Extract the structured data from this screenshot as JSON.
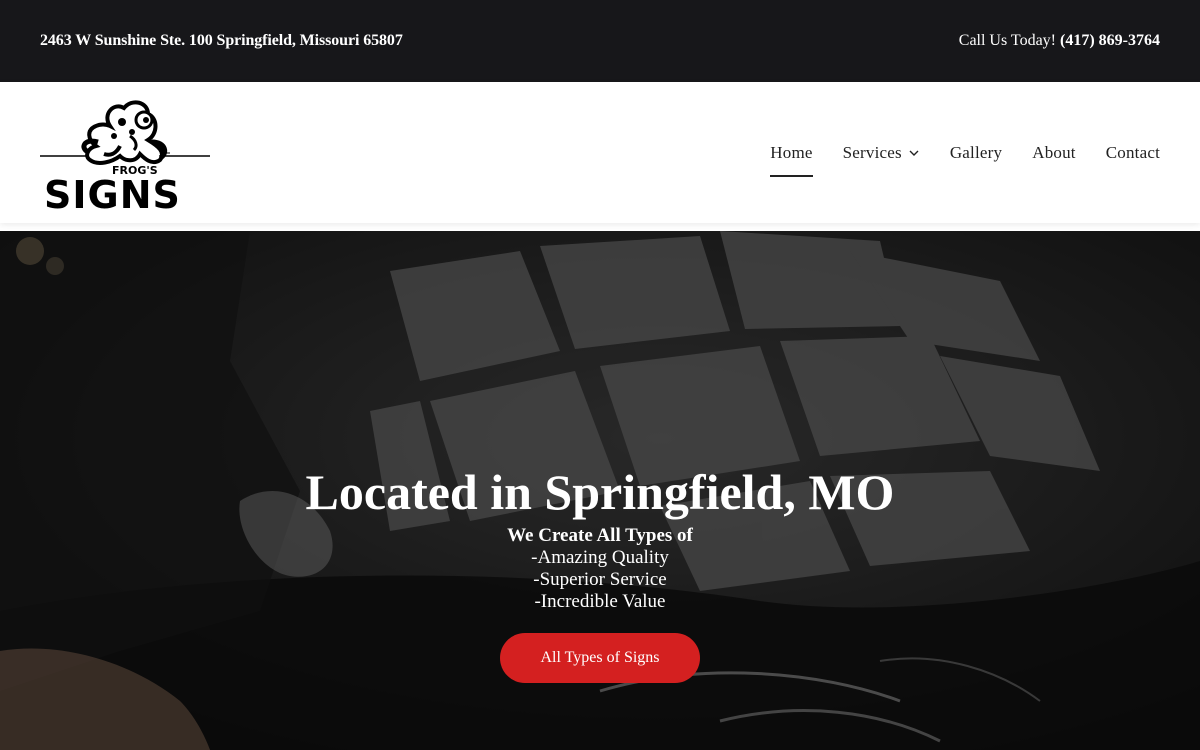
{
  "topbar": {
    "address": "2463 W Sunshine Ste. 100 Springfield, Missouri 65807",
    "phone_prefix": "Call Us Today!",
    "phone_number": "(417) 869-3764"
  },
  "logo": {
    "small_text": "FROG'S",
    "main_text": "SIGNS",
    "icon": "frog-icon"
  },
  "nav": {
    "items": [
      {
        "label": "Home",
        "active": true
      },
      {
        "label": "Services",
        "has_dropdown": true
      },
      {
        "label": "Gallery"
      },
      {
        "label": "About"
      },
      {
        "label": "Contact"
      }
    ]
  },
  "hero": {
    "title": "Located in Springfield, MO",
    "subtitle": "We Create All Types of",
    "lines": [
      "-Amazing Quality",
      "-Superior Service",
      "-Incredible Value"
    ],
    "button_label": "All Types of Signs"
  },
  "colors": {
    "topbar_bg": "#17171a",
    "accent": "#d42020",
    "header_bg": "#ffffff"
  }
}
